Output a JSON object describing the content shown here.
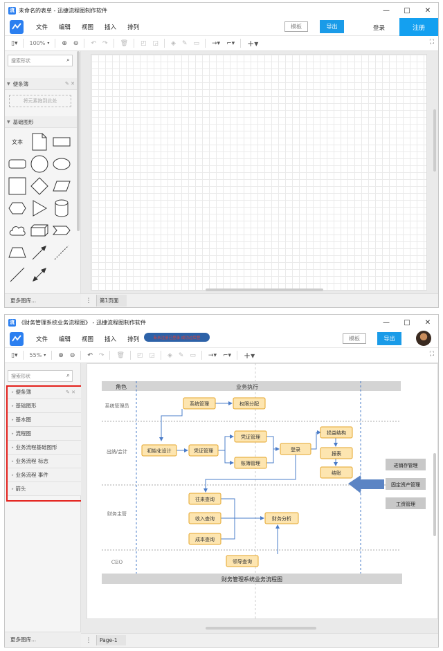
{
  "window1": {
    "title": "未命名的表单 - 迅捷流程图制作软件",
    "app_icon": "流",
    "controls": [
      "—",
      "□",
      "✕"
    ],
    "menu": [
      "文件",
      "编辑",
      "视图",
      "插入",
      "排列"
    ],
    "template_label": "模板",
    "export_label": "导出",
    "login_label": "登录",
    "register_label": "注册",
    "zoom": "100%",
    "search_placeholder": "搜索形状",
    "scratchpad": {
      "label": "便条簿",
      "drop_hint": "将元素拖到此处"
    },
    "basic_shapes": {
      "label": "基础图形",
      "text_shape": "文本"
    },
    "more_libraries": "更多图库...",
    "page_tab": "第1页面"
  },
  "window2": {
    "title": "《财务管理系统业务流程图》 - 迅捷流程图制作软件",
    "app_icon": "流",
    "controls": [
      "—",
      "□",
      "✕"
    ],
    "menu": [
      "文件",
      "编辑",
      "视图",
      "插入",
      "排列"
    ],
    "notice": "新未注册已登录 成功过后登",
    "template_label": "模板",
    "export_label": "导出",
    "zoom": "55%",
    "search_placeholder": "搜索形状",
    "libraries": [
      "便条簿",
      "基础图形",
      "基本图",
      "流程图",
      "业务流程基础图形",
      "业务流程 标志",
      "业务流程 事件",
      "箭头"
    ],
    "more_libraries": "更多图库...",
    "page_tab": "Page-1"
  },
  "diagram": {
    "header_role": "角色",
    "header_exec": "业务执行",
    "lanes": [
      "系统管理员",
      "出纳/会计",
      "财务主管",
      "CEO"
    ],
    "nodes": {
      "sys_mgmt": "系统管理",
      "perm": "权限分配",
      "init": "初始化设计",
      "voucher": "凭证管理",
      "voucher2": "凭证管理",
      "ledger": "账簿管理",
      "login": "登录",
      "pl": "损益结构",
      "report": "报表",
      "close": "结账",
      "recv": "往来查询",
      "income": "收入查询",
      "cost": "成本查询",
      "analysis": "财务分析",
      "leader": "领导查询"
    },
    "side": [
      "进销存管理",
      "固定资产管理",
      "工资管理"
    ],
    "footer": "财务管理系统业务流程图",
    "colors": {
      "node_fill": "#fde5b0",
      "node_border": "#e4a52a",
      "arrow": "#4a7cc9",
      "header": "#d4d4d4",
      "side_fill": "#c8c8c8"
    }
  }
}
